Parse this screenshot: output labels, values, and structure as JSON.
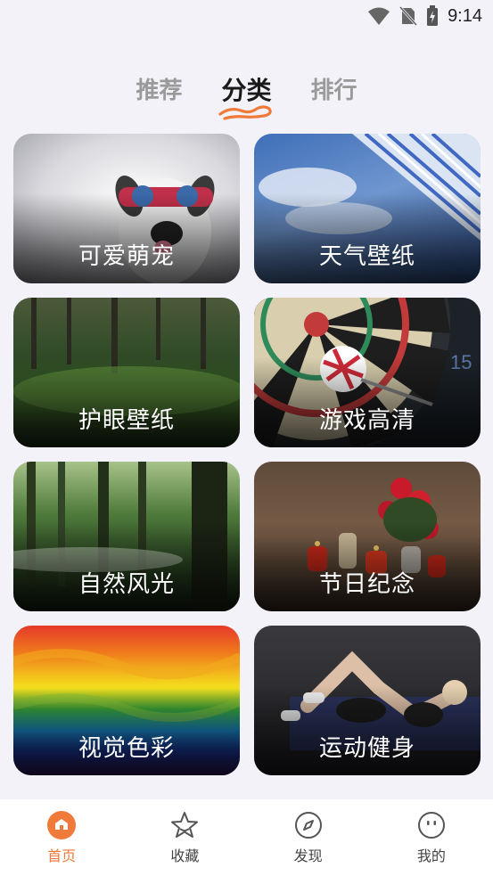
{
  "status": {
    "time": "9:14"
  },
  "tabs": [
    {
      "label": "推荐",
      "active": false
    },
    {
      "label": "分类",
      "active": true
    },
    {
      "label": "排行",
      "active": false
    }
  ],
  "categories": [
    {
      "label": "可爱萌宠"
    },
    {
      "label": "天气壁纸"
    },
    {
      "label": "护眼壁纸"
    },
    {
      "label": "游戏高清"
    },
    {
      "label": "自然风光"
    },
    {
      "label": "节日纪念"
    },
    {
      "label": "视觉色彩"
    },
    {
      "label": "运动健身"
    }
  ],
  "nav": [
    {
      "label": "首页",
      "icon": "home-icon",
      "active": true
    },
    {
      "label": "收藏",
      "icon": "star-icon",
      "active": false
    },
    {
      "label": "发现",
      "icon": "compass-icon",
      "active": false
    },
    {
      "label": "我的",
      "icon": "face-icon",
      "active": false
    }
  ],
  "colors": {
    "accent": "#f07a3a",
    "background": "#f2f2f8"
  }
}
